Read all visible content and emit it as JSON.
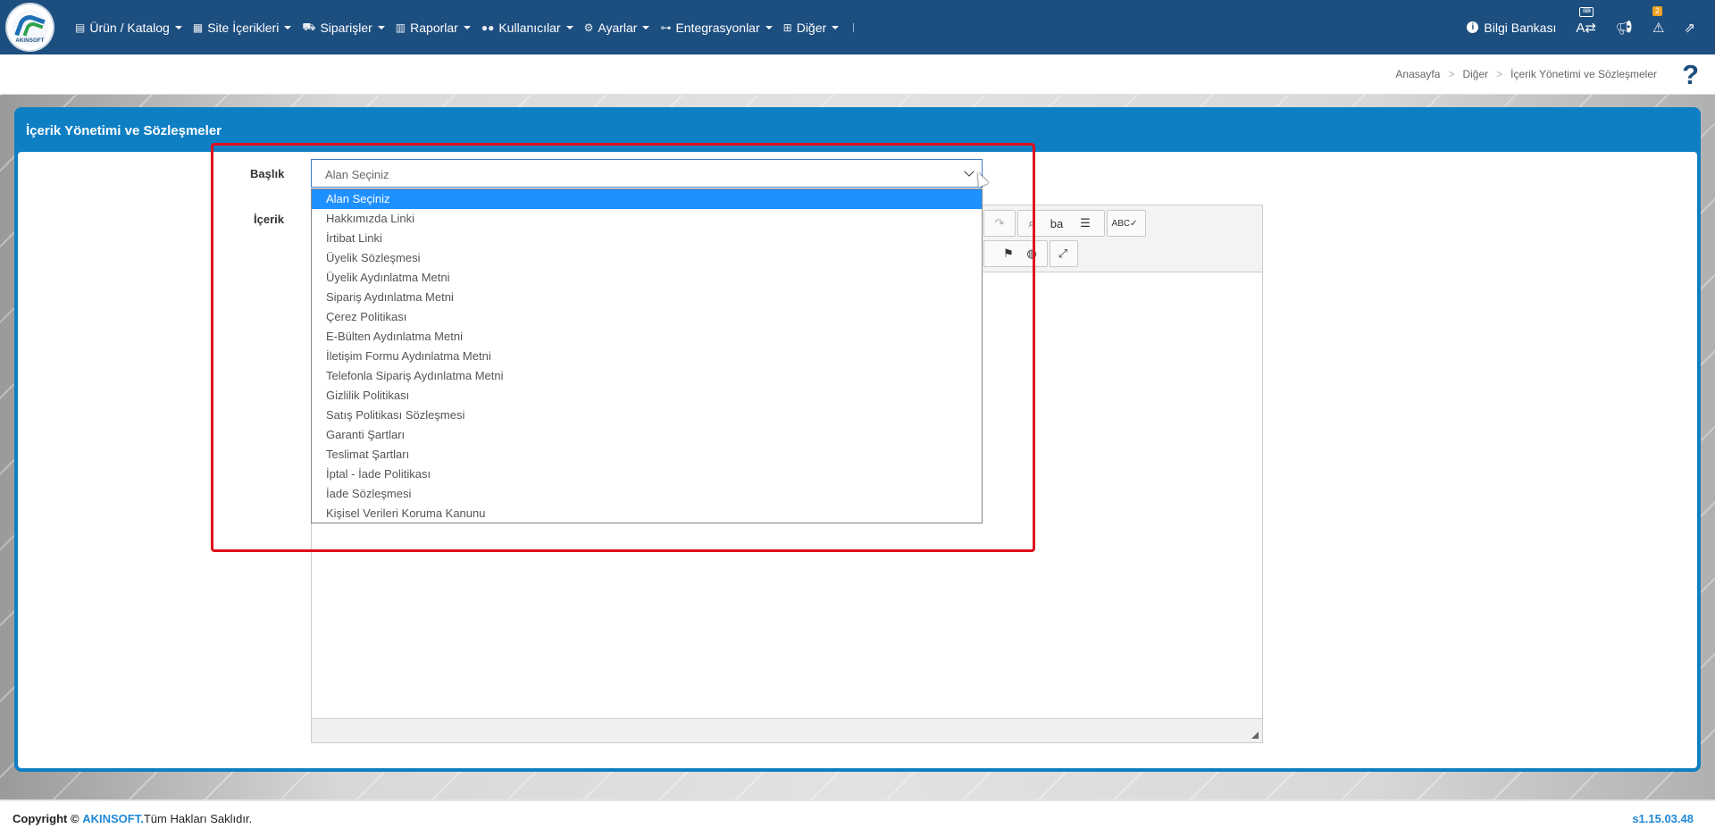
{
  "nav": {
    "logo_text": "AKINSOFT",
    "menu": [
      {
        "label": "Ürün / Katalog",
        "icon": "boxes-icon"
      },
      {
        "label": "Site İçerikleri",
        "icon": "document-icon"
      },
      {
        "label": "Siparişler",
        "icon": "truck-icon"
      },
      {
        "label": "Raporlar",
        "icon": "report-icon"
      },
      {
        "label": "Kullanıcılar",
        "icon": "users-icon"
      },
      {
        "label": "Ayarlar",
        "icon": "gears-icon"
      },
      {
        "label": "Entegrasyonlar",
        "icon": "network-icon"
      },
      {
        "label": "Diğer",
        "icon": "grid-icon"
      }
    ],
    "bilgi_bankasi": "Bilgi Bankası",
    "warning_count": "2"
  },
  "breadcrumb": {
    "home": "Anasayfa",
    "level1": "Diğer",
    "current": "İçerik Yönetimi ve Sözleşmeler"
  },
  "help_symbol": "?",
  "panel": {
    "title": "İçerik Yönetimi ve Sözleşmeler",
    "baslik_label": "Başlık",
    "icerik_label": "İçerik",
    "select_value": "Alan Seçiniz",
    "options": [
      "Alan Seçiniz",
      "Hakkımızda Linki",
      "İrtibat Linki",
      "Üyelik Sözleşmesi",
      "Üyelik Aydınlatma Metni",
      "Sipariş Aydınlatma Metni",
      "Çerez Politikası",
      "E-Bülten Aydınlatma Metni",
      "İletişim Formu Aydınlatma Metni",
      "Telefonla Sipariş Aydınlatma Metni",
      "Gizlilik Politikası",
      "Satış Politikası Sözleşmesi",
      "Garanti Şartları",
      "Teslimat Şartları",
      "İptal - İade Politikası",
      "İade Sözleşmesi",
      "Kişisel Verileri Koruma Kanunu"
    ],
    "selected_index": 0
  },
  "footer": {
    "copyright": "Copyright ©",
    "brand": "AKINSOFT.",
    "rights": "Tüm Hakları Saklıdır.",
    "version": "s1.15.03.48"
  },
  "colors": {
    "navbar": "#1d4e80",
    "panel": "#0f7fc4",
    "highlight": "#e0101b",
    "selected_option": "#1e90ff"
  }
}
